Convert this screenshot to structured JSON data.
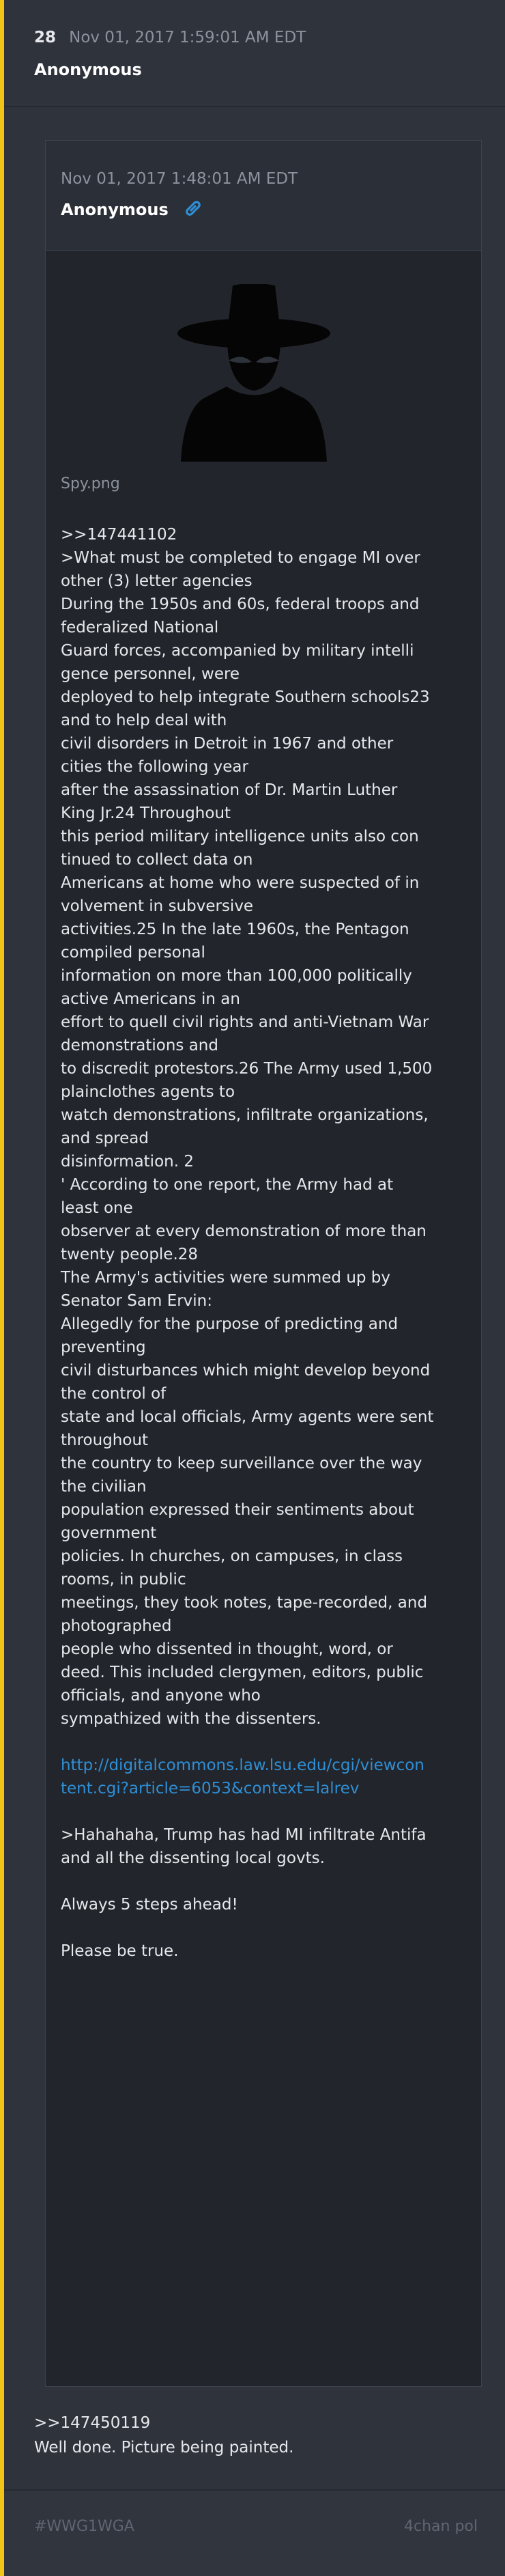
{
  "post": {
    "number": "28",
    "date": "Nov 01, 2017 1:59:01 AM EDT",
    "author": "Anonymous",
    "accent_color": "#f0c419"
  },
  "quoted": {
    "date": "Nov 01, 2017 1:48:01 AM EDT",
    "author": "Anonymous",
    "link_icon": "link-icon",
    "image_icon": "spy-icon",
    "filename": "Spy.png",
    "lines": [
      ">>147441102",
      ">What must be completed to engage MI over",
      "other (3) letter agencies",
      "During the 1950s and 60s, federal troops and",
      "federalized National",
      "Guard forces, accompanied by military intelli",
      "gence personnel, were",
      "deployed to help integrate Southern schools23",
      "and to help deal with",
      "civil disorders in Detroit in 1967 and other",
      "cities the following year",
      "after the assassination of Dr. Martin Luther",
      "King Jr.24 Throughout",
      "this period military intelligence units also con",
      "tinued to collect data on",
      "Americans at home who were suspected of in",
      "volvement in subversive",
      "activities.25 In the late 1960s, the Pentagon",
      "compiled personal",
      "information on more than 100,000 politically",
      "active Americans in an",
      "effort to quell civil rights and anti-Vietnam War",
      "demonstrations and",
      "to discredit protestors.26 The Army used 1,500",
      "plainclothes agents to",
      "watch demonstrations, infiltrate organizations,",
      "and spread",
      "disinformation. 2",
      "' According to one report, the Army had at",
      "least one",
      "observer at every demonstration of more than",
      "twenty people.28",
      "The Army's activities were summed up by",
      "Senator Sam Ervin:",
      "Allegedly for the purpose of predicting and",
      "preventing",
      "civil disturbances which might develop beyond",
      "the control of",
      "state and local officials, Army agents were sent",
      "throughout",
      "the country to keep surveillance over the way",
      "the civilian",
      "population expressed their sentiments about",
      "government",
      "policies. In churches, on campuses, in class",
      "rooms, in public",
      "meetings, they took notes, tape-recorded, and",
      "photographed",
      "people who dissented in thought, word, or",
      "deed. This included clergymen, editors, public",
      "officials, and anyone who",
      "sympathized with the dissenters."
    ],
    "url_line1": "http://digitalcommons.law.lsu.edu/cgi/viewcon",
    "url_line2": "tent.cgi?article=6053&context=lalrev",
    "closing": [
      ">Hahahaha, Trump has had MI infiltrate Antifa",
      "and all the dissenting local govts."
    ],
    "closing2": "Always 5 steps ahead!",
    "closing3": "Please be true."
  },
  "reply": {
    "ref": ">>147450119",
    "text": "Well done. Picture being painted."
  },
  "footer": {
    "hashtag": "#WWG1WGA",
    "board": "4chan pol"
  }
}
